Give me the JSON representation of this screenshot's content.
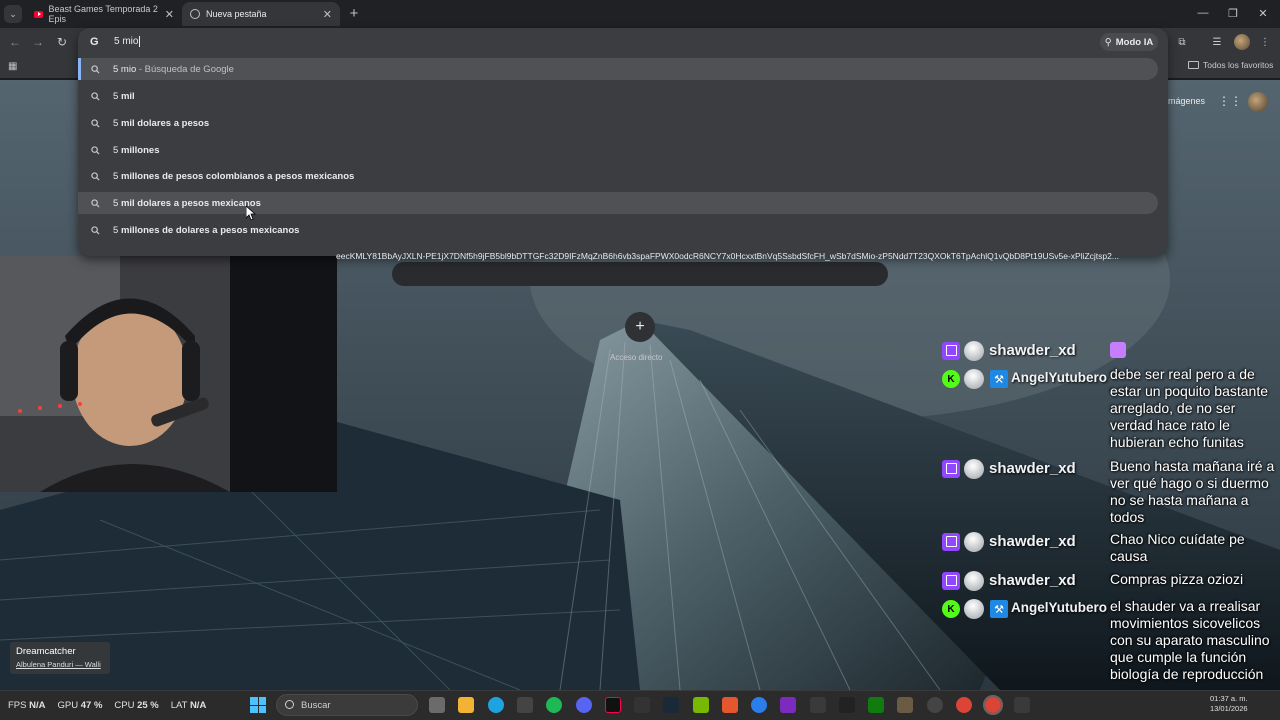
{
  "tabs": [
    {
      "title": "Beast Games Temporada 2 Epis",
      "active": false,
      "icon": "youtube-icon"
    },
    {
      "title": "Nueva pestaña",
      "active": true,
      "icon": "globe-icon"
    }
  ],
  "omnibox": {
    "value": "5 mio",
    "engine_icon": "G"
  },
  "toolbar": {
    "modo_ia_label": "Modo IA"
  },
  "bookmarks": {
    "all_favorites_label": "Todos los favoritos"
  },
  "suggestions": [
    {
      "prefix": "5 mio",
      "bold": "",
      "suffix": " - Búsqueda de Google",
      "highlighted": false,
      "selected": true
    },
    {
      "prefix": "5 ",
      "bold": "mil",
      "suffix": "",
      "highlighted": false,
      "selected": false
    },
    {
      "prefix": "5 ",
      "bold": "mil dolares a pesos",
      "suffix": "",
      "highlighted": false,
      "selected": false
    },
    {
      "prefix": "5 ",
      "bold": "millones",
      "suffix": "",
      "highlighted": false,
      "selected": false
    },
    {
      "prefix": "5 ",
      "bold": "millones de pesos colombianos a pesos mexicanos",
      "suffix": "",
      "highlighted": false,
      "selected": false
    },
    {
      "prefix": "5 ",
      "bold": "mil dolares a pesos mexicanos",
      "suffix": "",
      "highlighted": true,
      "selected": false
    },
    {
      "prefix": "5 ",
      "bold": "millones de dolares a pesos mexicanos",
      "suffix": "",
      "highlighted": false,
      "selected": false
    }
  ],
  "url_fragment": "eecKMLY81BbAyJXLN-PE1jX7DNf5h9jFB5bl9bDTTGFc32D9IFzMqZnB6h6vb3spaFPWX0odcR6NCY7x0HcxxtBnVq5SsbdSfcFH_wSb7dSMio-zP5Ndd7T23QXOkT6TpAchlQ1vQbD8Pt19USv5e-xPliZcjtsp2...",
  "ntp": {
    "imagenes_label": "mágenes",
    "shortcut_label": "Acceso directo"
  },
  "chat": [
    {
      "platform": "twitch",
      "user": "shawder_xd",
      "message": "",
      "emote": true
    },
    {
      "platform": "kick",
      "user": "AngelYutubero",
      "message": "debe ser real pero a de estar un poquito bastante arreglado, de no ser verdad hace rato le hubieran echo funitas"
    },
    {
      "platform": "twitch",
      "user": "shawder_xd",
      "message": "Bueno hasta mañana iré a ver qué hago o si duermo no se hasta mañana a todos"
    },
    {
      "platform": "twitch",
      "user": "shawder_xd",
      "message": "Chao Nico cuídate pe causa"
    },
    {
      "platform": "twitch",
      "user": "shawder_xd",
      "message": "Compras pizza oziozi"
    },
    {
      "platform": "kick",
      "user": "AngelYutubero",
      "message": "el shauder va a rrealisar movimientos sicovelicos con su aparato masculino que cumple la función biología de reproducción"
    }
  ],
  "now_playing": {
    "title": "Dreamcatcher",
    "subtitle": "Albulena Panduri — Walli"
  },
  "stats": {
    "fps_label": "FPS",
    "fps_value": "N/A",
    "gpu_label": "GPU",
    "gpu_value": "47 %",
    "cpu_label": "CPU",
    "cpu_value": "25 %",
    "lat_label": "LAT",
    "lat_value": "N/A"
  },
  "taskbar": {
    "search_placeholder": "Buscar",
    "time": "01:37 a. m.",
    "date": "13/01/2026"
  }
}
